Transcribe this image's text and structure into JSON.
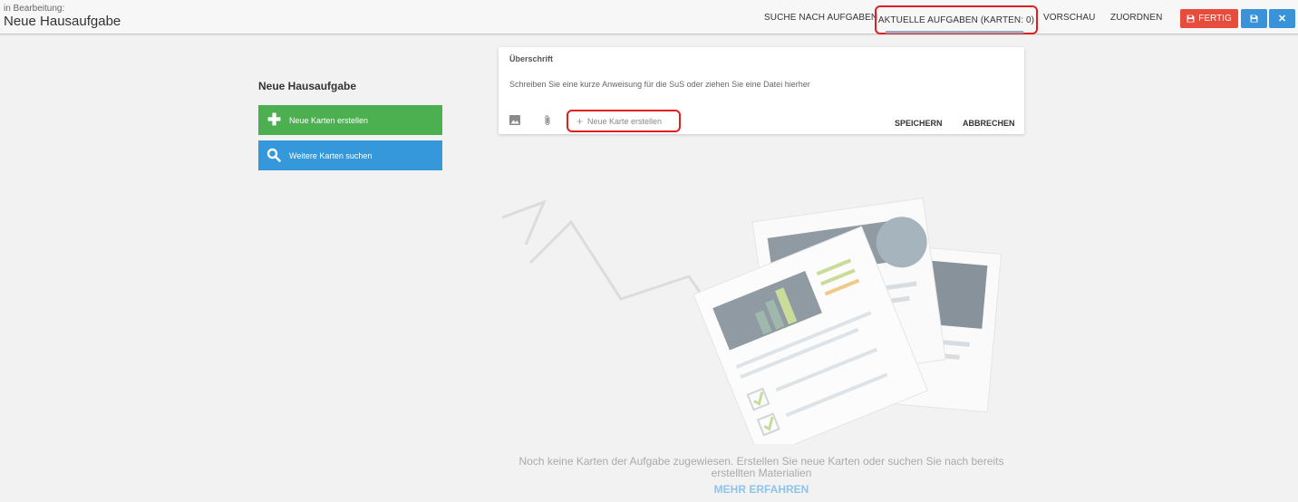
{
  "header": {
    "edit_label": "in Bearbeitung:",
    "title": "Neue Hausaufgabe",
    "nav": {
      "search": "SUCHE NACH AUFGABEN",
      "current": "AKTUELLE AUFGABEN (KARTEN: 0)",
      "preview": "VORSCHAU",
      "assign": "ZUORDNEN"
    },
    "done_label": "FERTIG",
    "save_icon": "floppy-disk-icon",
    "close_icon": "close-icon"
  },
  "left_panel": {
    "title": "Neue Hausaufgabe",
    "new_cards_label": "Neue Karten erstellen",
    "find_cards_label": "Weitere Karten suchen"
  },
  "editor": {
    "heading": "Überschrift",
    "instruction": "Schreiben Sie eine kurze Anweisung für die SuS oder ziehen Sie eine Datei hierher",
    "new_card_label": "Neue Karte erstellen",
    "save_label": "SPEICHERN",
    "cancel_label": "ABBRECHEN"
  },
  "empty_state": {
    "message": "Noch keine Karten der Aufgabe zugewiesen. Erstellen Sie neue Karten oder suchen Sie nach bereits erstellten Materialien",
    "learn_more": "MEHR ERFAHREN"
  },
  "colors": {
    "done": "#e84c3d",
    "primary": "#3a93d8",
    "green": "#4caf50",
    "highlight": "#e01f1f"
  }
}
